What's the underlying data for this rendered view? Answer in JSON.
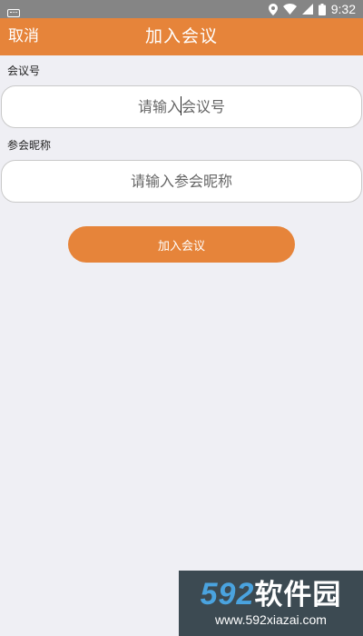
{
  "status_bar": {
    "time": "9:32",
    "icons": [
      "keyboard-icon",
      "location-icon",
      "wifi-icon",
      "signal-icon",
      "battery-icon"
    ]
  },
  "header": {
    "cancel_label": "取消",
    "title": "加入会议",
    "background": "#e6843a"
  },
  "form": {
    "meeting_id": {
      "label": "会议号",
      "placeholder": "请输入会议号",
      "value": ""
    },
    "nickname": {
      "label": "参会昵称",
      "placeholder": "请输入参会昵称",
      "value": ""
    },
    "join_button_label": "加入会议"
  },
  "watermark": {
    "brand_number": "592",
    "brand_text": "软件园",
    "url": "www.592xiazai.com"
  },
  "colors": {
    "accent": "#e6843a",
    "page_background": "#efeff4"
  }
}
